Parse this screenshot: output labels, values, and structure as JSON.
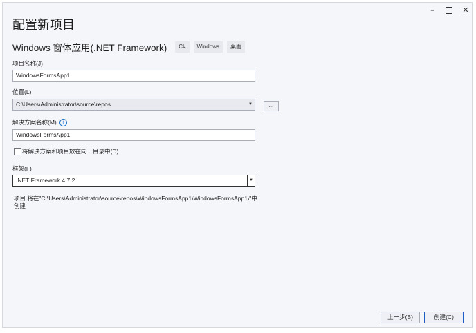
{
  "window": {
    "minimize_glyph": "–",
    "close_glyph": "✕"
  },
  "header": {
    "title": "配置新项目",
    "template_name": "Windows 窗体应用(.NET Framework)",
    "tags": [
      "C#",
      "Windows",
      "桌面"
    ]
  },
  "form": {
    "project_name_label": "项目名称(J)",
    "project_name_value": "WindowsFormsApp1",
    "location_label": "位置(L)",
    "location_value": "C:\\Users\\Administrator\\source\\repos",
    "browse_label": "...",
    "solution_name_label": "解决方案名称(M)",
    "solution_name_value": "WindowsFormsApp1",
    "same_dir_label": "将解决方案和项目放在同一目录中(D)",
    "same_dir_checked": false,
    "framework_label": "框架(F)",
    "framework_value": ".NET Framework 4.7.2",
    "path_info": "项目 将在\"C:\\Users\\Administrator\\source\\repos\\WindowsFormsApp1\\WindowsFormsApp1\\\"中创建"
  },
  "buttons": {
    "back": "上一步(B)",
    "create": "创建(C)"
  },
  "colors": {
    "accent": "#1f5ec8",
    "info": "#1a73c9"
  }
}
